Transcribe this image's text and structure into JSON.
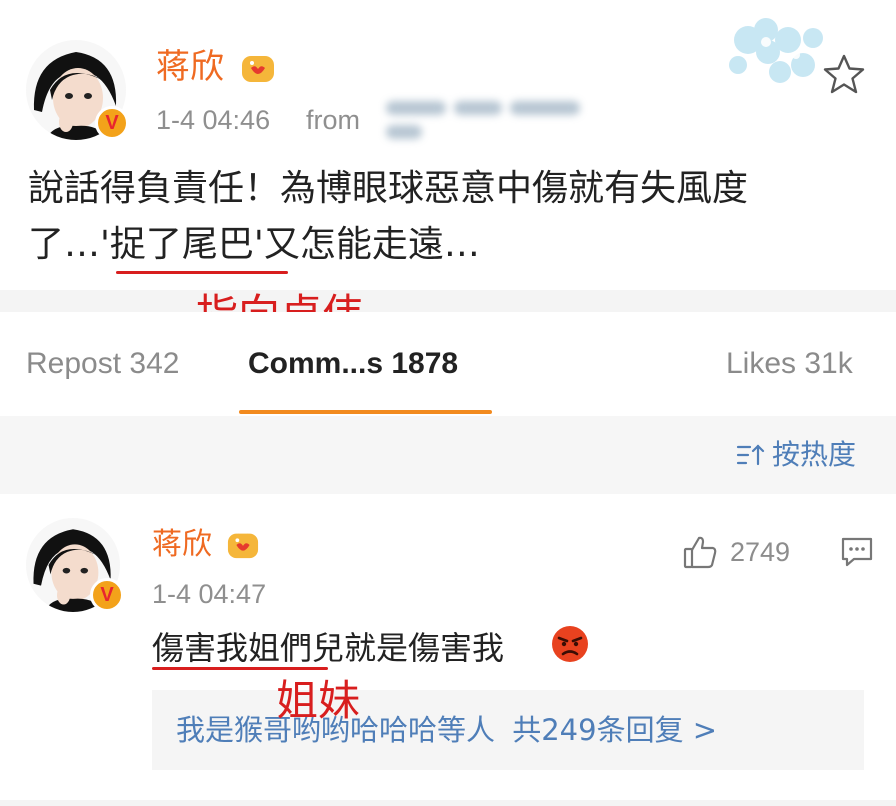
{
  "post": {
    "username": "蒋欣",
    "verified_mark": "V",
    "time": "1-4 04:46",
    "from_label": "from",
    "text_line1": "說話得負責任！為博眼球惡意中傷就有失風度",
    "text_line2_a": "了…'",
    "text_line2_b": "捉了尾巴",
    "text_line2_c": "'又怎能走遠…",
    "annotation": "指向卓伟",
    "icons": [
      "avatar",
      "verified-badge",
      "vip-crown-icon",
      "flower-decoration",
      "star-icon"
    ]
  },
  "tabs": {
    "repost": "Repost 342",
    "comments": "Comm...s 1878",
    "likes": "Likes 31k"
  },
  "sort": {
    "icon": "sort-icon",
    "label": "按热度"
  },
  "comment": {
    "username": "蒋欣",
    "verified_mark": "V",
    "time": "1-4 04:47",
    "likes": "2749",
    "text": "傷害我姐們兒就是傷害我",
    "annotation": "姐妹",
    "replies_names": "我是猴哥哟哟哈哈哈等人",
    "replies_count": "共249条回复 >",
    "icons": [
      "avatar",
      "verified-badge",
      "vip-crown-icon",
      "thumbs-up-icon",
      "comment-icon",
      "angry-emoji-icon"
    ]
  },
  "colors": {
    "username": "#ef6a22",
    "link": "#4f7eb8",
    "annotation_red": "#d81e1e",
    "tab_underline": "#f28a1e"
  }
}
